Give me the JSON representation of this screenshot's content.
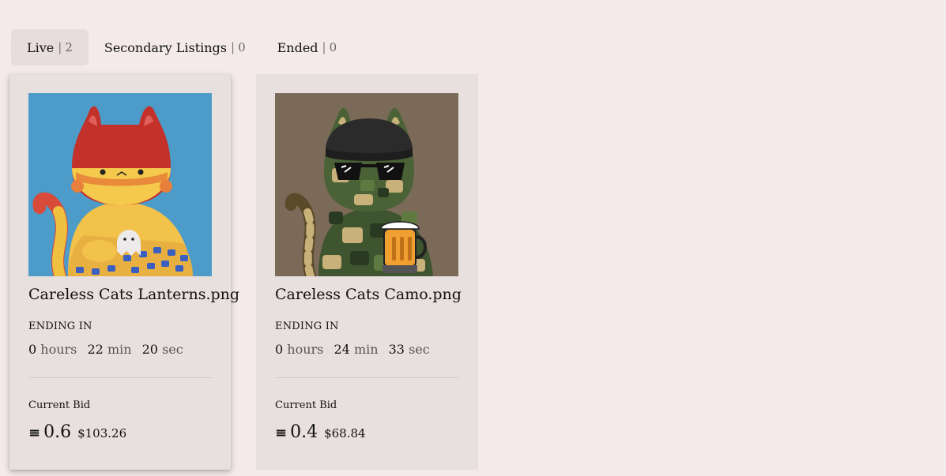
{
  "tabs": [
    {
      "label": "Live",
      "sep": "|",
      "count": "2"
    },
    {
      "label": "Secondary Listings",
      "sep": "|",
      "count": "0"
    },
    {
      "label": "Ended",
      "sep": "|",
      "count": "0"
    }
  ],
  "cards": [
    {
      "title": "Careless Cats Lanterns.png",
      "ending_label": "ENDING IN",
      "hours": "0",
      "hours_unit": "hours",
      "min": "22",
      "min_unit": "min",
      "sec": "20",
      "sec_unit": "sec",
      "bid_label": "Current Bid",
      "eth_symbol": "≡",
      "bid": "0.6",
      "usd": "$103.26"
    },
    {
      "title": "Careless Cats Camo.png",
      "ending_label": "ENDING IN",
      "hours": "0",
      "hours_unit": "hours",
      "min": "24",
      "min_unit": "min",
      "sec": "33",
      "sec_unit": "sec",
      "bid_label": "Current Bid",
      "eth_symbol": "≡",
      "bid": "0.4",
      "usd": "$68.84"
    }
  ],
  "colors": {
    "background": "#f4eaea",
    "card": "#e8dfdf",
    "active_tab": "#e8dddd"
  },
  "icons": [
    "eth-icon",
    "cat-lanterns-artwork",
    "cat-camo-artwork"
  ]
}
